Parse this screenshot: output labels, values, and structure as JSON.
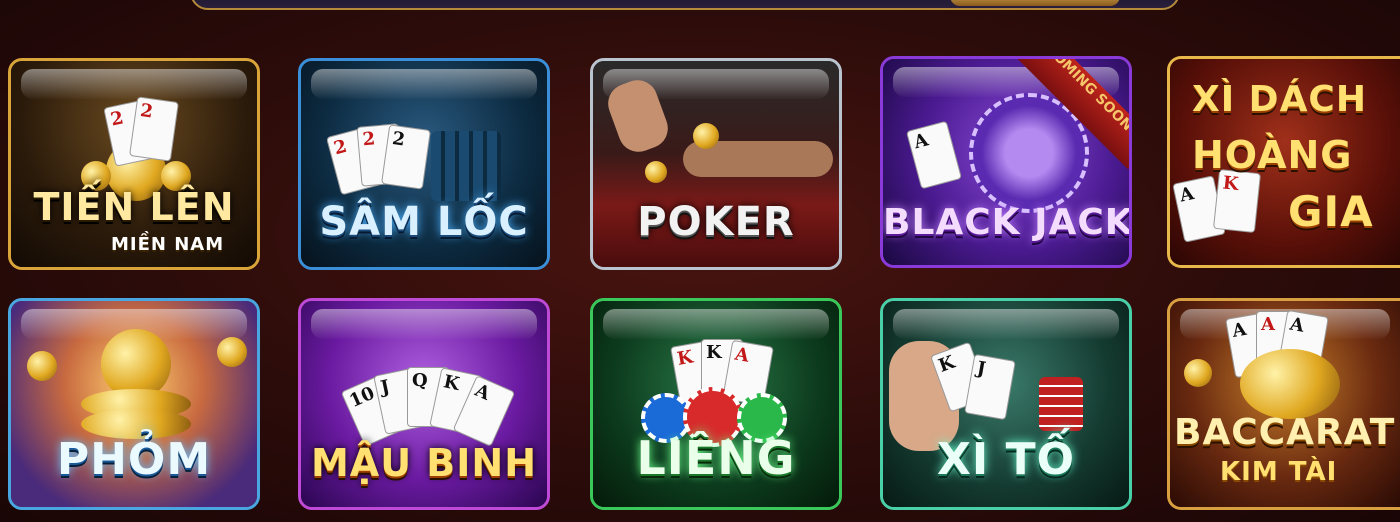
{
  "games": [
    {
      "title": "TIẾN LÊN",
      "subtitle": "MIỀN NAM",
      "icon": "club-chip-icon"
    },
    {
      "title": "SÂM LỐC",
      "icon": "playing-cards-icon"
    },
    {
      "title": "POKER",
      "icon": "poker-table-icon"
    },
    {
      "title": "BLACK JACK",
      "badge": "COMING SOON",
      "icon": "spade-chip-icon"
    },
    {
      "title_line1": "XÌ DÁCH",
      "title_line2": "HOÀNG",
      "title_line3": "GIA",
      "icon": "ace-king-icon"
    },
    {
      "title": "PHỎM",
      "icon": "gold-coins-icon"
    },
    {
      "title": "MẬU BINH",
      "icon": "card-fan-icon"
    },
    {
      "title": "LIÊNG",
      "icon": "chip-stack-icon"
    },
    {
      "title": "XÌ TỐ",
      "icon": "hand-cards-icon"
    },
    {
      "title": "BACCARAT",
      "subtitle": "KIM TÀI",
      "icon": "gold-medal-icon"
    }
  ],
  "card_ranks": {
    "two": "2",
    "ace": "A",
    "king": "K",
    "queen": "Q",
    "jack": "J",
    "ten": "10"
  },
  "colors": {
    "tienlen": "#d9a53a",
    "samloc": "#3a8fd8",
    "poker": "#b9c4cf",
    "blackjack": "#8a3ad8",
    "xidach": "#e8b84a",
    "phom": "#4aa6e0",
    "maubinh": "#c04ad8",
    "lieng": "#3ac85a",
    "xito": "#4ad0a8",
    "baccarat": "#d8a040"
  }
}
